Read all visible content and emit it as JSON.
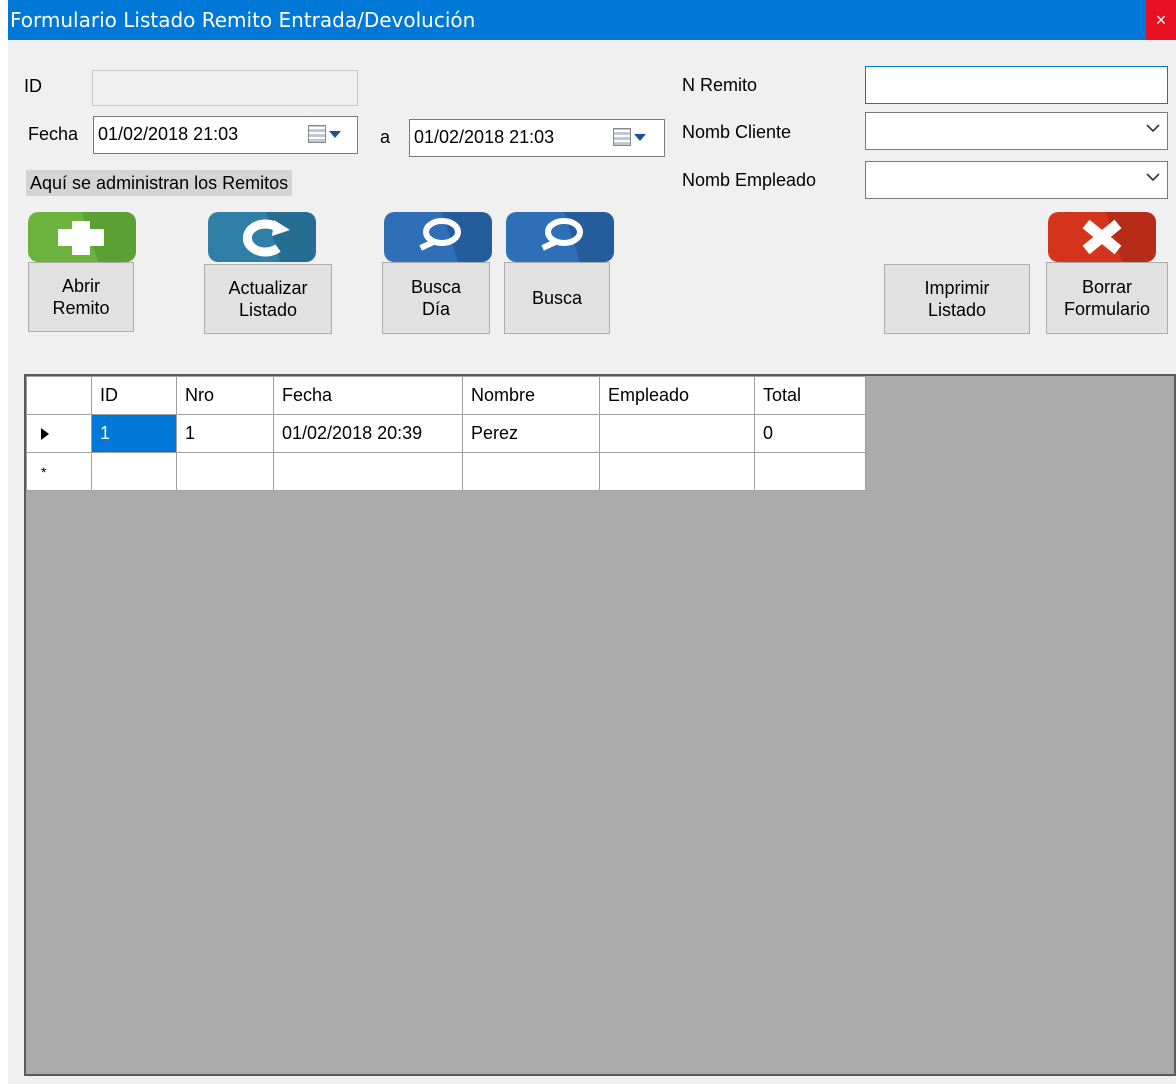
{
  "window": {
    "title": "Formulario Listado Remito Entrada/Devolución",
    "close_glyph": "×"
  },
  "form": {
    "id_label": "ID",
    "id_value": "",
    "fecha_label": "Fecha",
    "fecha_desde": "01/02/2018 21:03",
    "a_label": "a",
    "fecha_hasta": "01/02/2018 21:03",
    "info_label": "Aquí se administran los Remitos",
    "n_remito_label": "N Remito",
    "n_remito_value": "",
    "nomb_cliente_label": "Nomb Cliente",
    "nomb_cliente_value": "",
    "nomb_empleado_label": "Nomb Empleado",
    "nomb_empleado_value": ""
  },
  "toolbar": {
    "abrir_remito": "Abrir\nRemito",
    "actualizar_listado": "Actualizar\nListado",
    "busca_dia": "Busca\nDía",
    "busca": "Busca",
    "imprimir_listado": "Imprimir\nListado",
    "borrar_formulario": "Borrar\nFormulario"
  },
  "icons": {
    "abrir": "plus-icon",
    "actualizar": "refresh-icon",
    "busca_dia": "magnifier-icon",
    "busca": "magnifier-icon",
    "borrar": "close-x-icon",
    "colors": {
      "green": "#6cb33e",
      "teal": "#2f7fa7",
      "blue": "#2f6fb7",
      "red": "#d6351d"
    }
  },
  "grid": {
    "columns": [
      "ID",
      "Nro",
      "Fecha",
      "Nombre",
      "Empleado",
      "Total"
    ],
    "rows": [
      {
        "ID": "1",
        "Nro": "1",
        "Fecha": "01/02/2018 20:39",
        "Nombre": "Perez",
        "Empleado": "",
        "Total": "0"
      }
    ],
    "new_row_glyph": "*"
  },
  "colors": {
    "titlebar": "#0078d7",
    "close": "#e81123",
    "selection": "#0078d7",
    "grid_bg": "#ababab"
  }
}
